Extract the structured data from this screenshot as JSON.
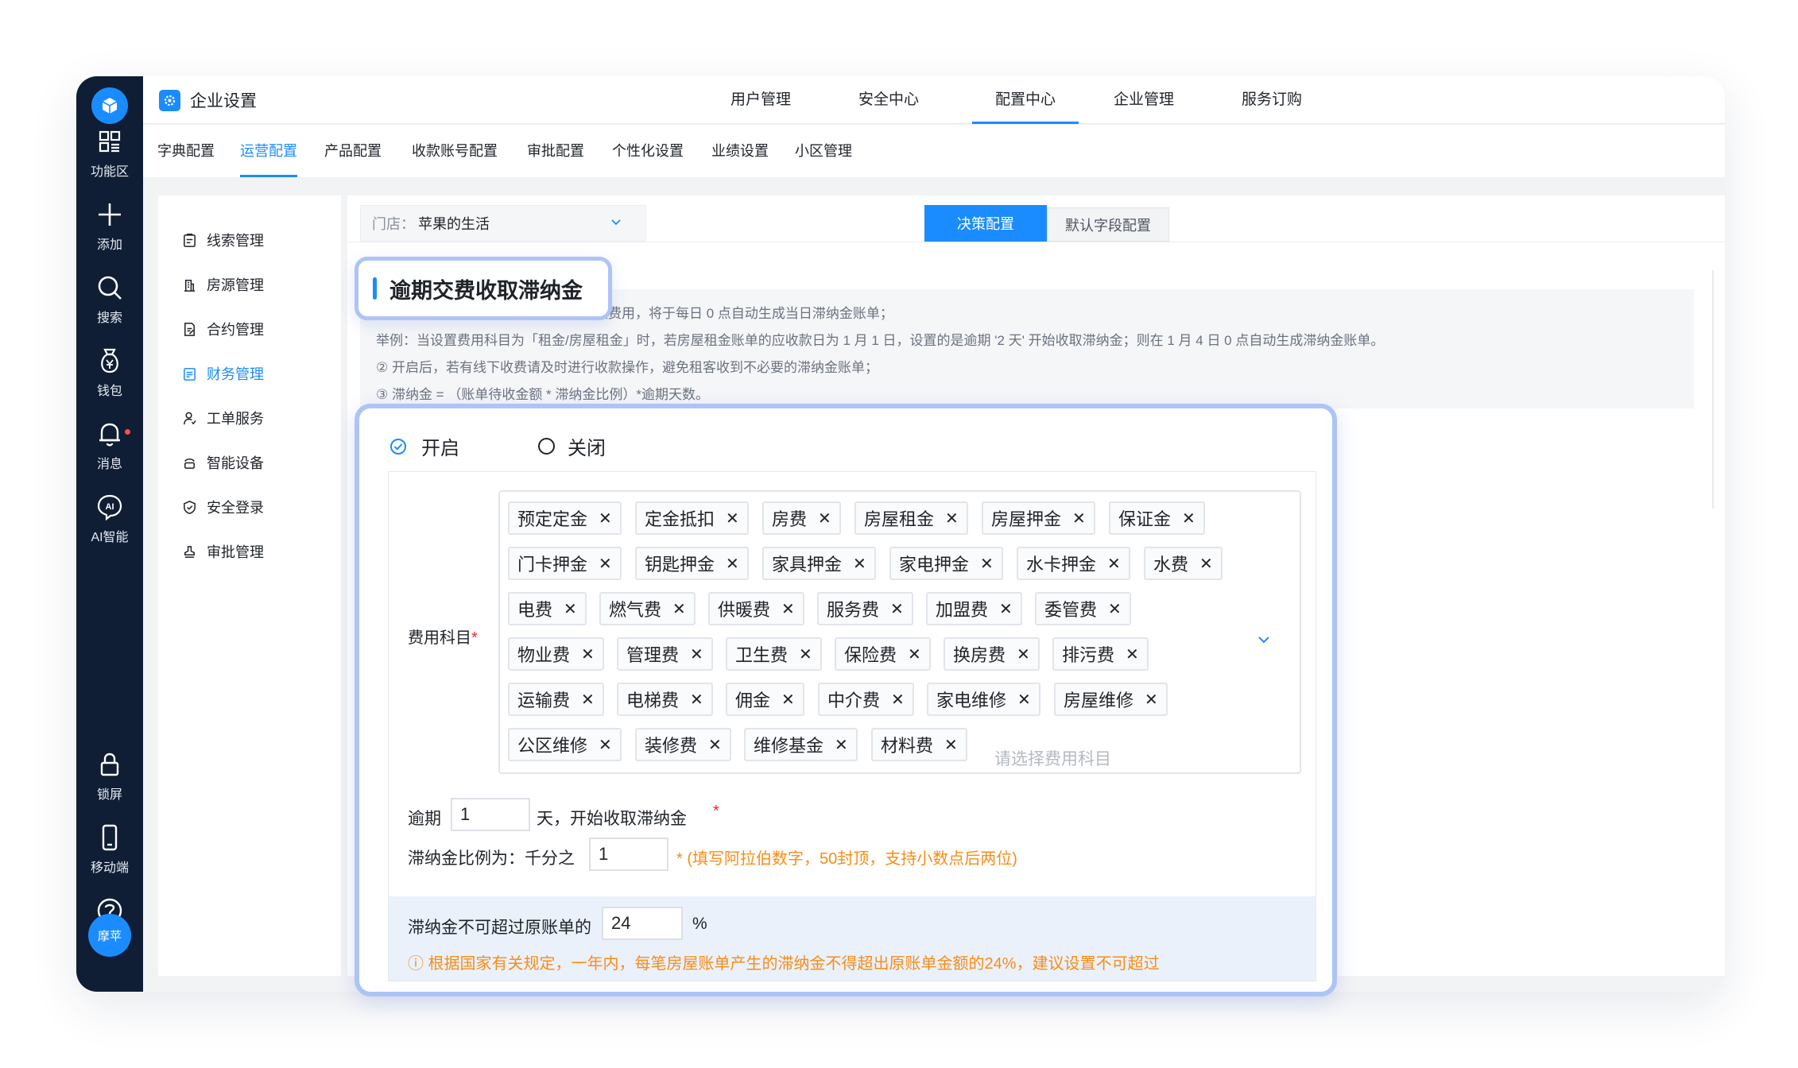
{
  "sidebar": {
    "items": [
      {
        "label": "功能区",
        "icon": "grid-icon"
      },
      {
        "label": "添加",
        "icon": "plus-icon"
      },
      {
        "label": "搜索",
        "icon": "search-icon"
      },
      {
        "label": "钱包",
        "icon": "wallet-icon"
      },
      {
        "label": "消息",
        "icon": "bell-icon"
      },
      {
        "label": "AI智能",
        "icon": "ai-icon"
      },
      {
        "label": "锁屏",
        "icon": "lock-icon"
      },
      {
        "label": "移动端",
        "icon": "mobile-icon"
      },
      {
        "label": "帮助",
        "icon": "help-icon"
      }
    ],
    "avatar": "摩苹"
  },
  "header": {
    "brand": "企业设置",
    "tabs": [
      "用户管理",
      "安全中心",
      "配置中心",
      "企业管理",
      "服务订购"
    ],
    "active_tab": "配置中心"
  },
  "subnav": {
    "tabs": [
      "字典配置",
      "运营配置",
      "产品配置",
      "收款账号配置",
      "审批配置",
      "个性化设置",
      "业绩设置",
      "小区管理"
    ],
    "active_tab": "运营配置"
  },
  "leftmenu": {
    "items": [
      "线索管理",
      "房源管理",
      "合约管理",
      "财务管理",
      "工单服务",
      "智能设备",
      "安全登录",
      "审批管理"
    ],
    "active": "财务管理"
  },
  "toolbar": {
    "store_prefix": "门店：",
    "store_value": "苹果的生活",
    "seg_active": "决策配置",
    "seg_inactive": "默认字段配置"
  },
  "section": {
    "title": "逾期交费收取滞纳金",
    "info_lines": [
      "项费用，将于每日 0 点自动生成当日滞纳金账单；",
      "举例：当设置费用科目为「租金/房屋租金」时，若房屋租金账单的应收款日为 1 月 1 日，设置的是逾期 '2 天' 开始收取滞纳金；则在 1 月 4 日 0 点自动生成滞纳金账单。",
      "② 开启后，若有线下收费请及时进行收款操作，避免租客收到不必要的滞纳金账单；",
      "③ 滞纳金 = （账单待收金额 * 滞纳金比例）*逾期天数。"
    ]
  },
  "form": {
    "radio_on": "开启",
    "radio_off": "关闭",
    "fee_label": "费用科目",
    "fee_tags": [
      [
        "预定定金",
        "定金抵扣",
        "房费",
        "房屋租金",
        "房屋押金",
        "保证金"
      ],
      [
        "门卡押金",
        "钥匙押金",
        "家具押金",
        "家电押金",
        "水卡押金",
        "水费"
      ],
      [
        "电费",
        "燃气费",
        "供暖费",
        "服务费",
        "加盟费",
        "委管费"
      ],
      [
        "物业费",
        "管理费",
        "卫生费",
        "保险费",
        "换房费",
        "排污费"
      ],
      [
        "运输费",
        "电梯费",
        "佣金",
        "中介费",
        "家电维修",
        "房屋维修"
      ],
      [
        "公区维修",
        "装修费",
        "维修基金",
        "材料费"
      ]
    ],
    "fee_placeholder": "请选择费用科目",
    "overdue_prefix": "逾期",
    "overdue_value": "1",
    "overdue_suffix": "天，开始收取滞纳金",
    "ratio_label": "滞纳金比例为：千分之",
    "ratio_value": "1",
    "ratio_hint": "* (填写阿拉伯数字，50封顶，支持小数点后两位)",
    "cap_label": "滞纳金不可超过原账单的",
    "cap_value": "24",
    "cap_unit": "%",
    "cap_warning": "ⓘ 根据国家有关规定，一年内，每笔房屋账单产生的滞纳金不得超出原账单金额的24%，建议设置不可超过"
  },
  "colors": {
    "accent": "#1a8cff",
    "sidebar": "#0f1e35",
    "highlight_border": "#aec4f6",
    "warning": "#fa8c16"
  }
}
